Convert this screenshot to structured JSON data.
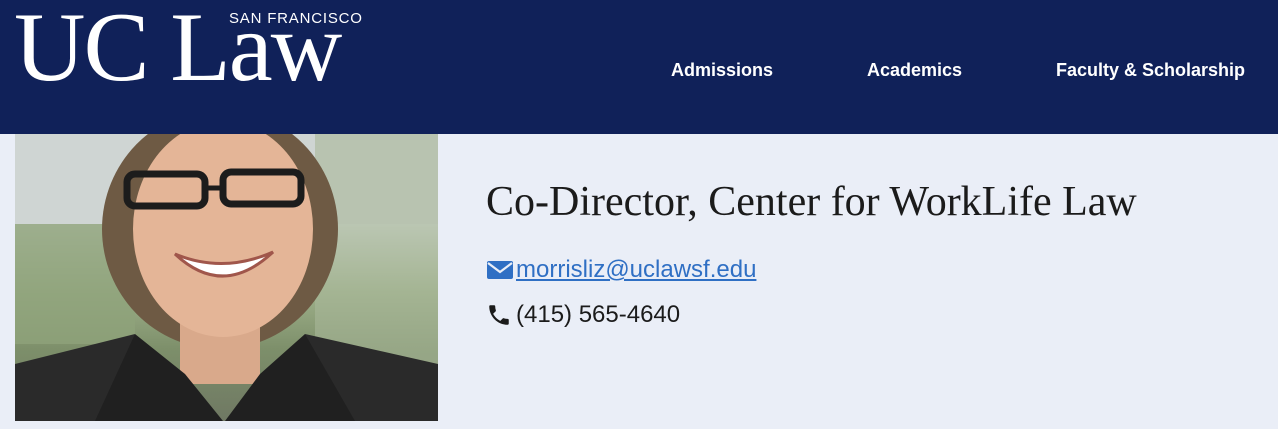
{
  "header": {
    "logo": {
      "main": "UC Law",
      "tagline": "SAN FRANCISCO"
    },
    "nav": [
      "Admissions",
      "Academics",
      "Faculty & Scholarship"
    ]
  },
  "profile": {
    "title": "Co-Director, Center for WorkLife Law",
    "email": "morrisliz@uclawsf.edu",
    "phone": "(415) 565-4640"
  },
  "colors": {
    "header_bg": "#102159",
    "page_bg": "#eaeef7",
    "link": "#2f6fc4"
  },
  "icons": {
    "email": "envelope-icon",
    "phone": "phone-icon"
  }
}
